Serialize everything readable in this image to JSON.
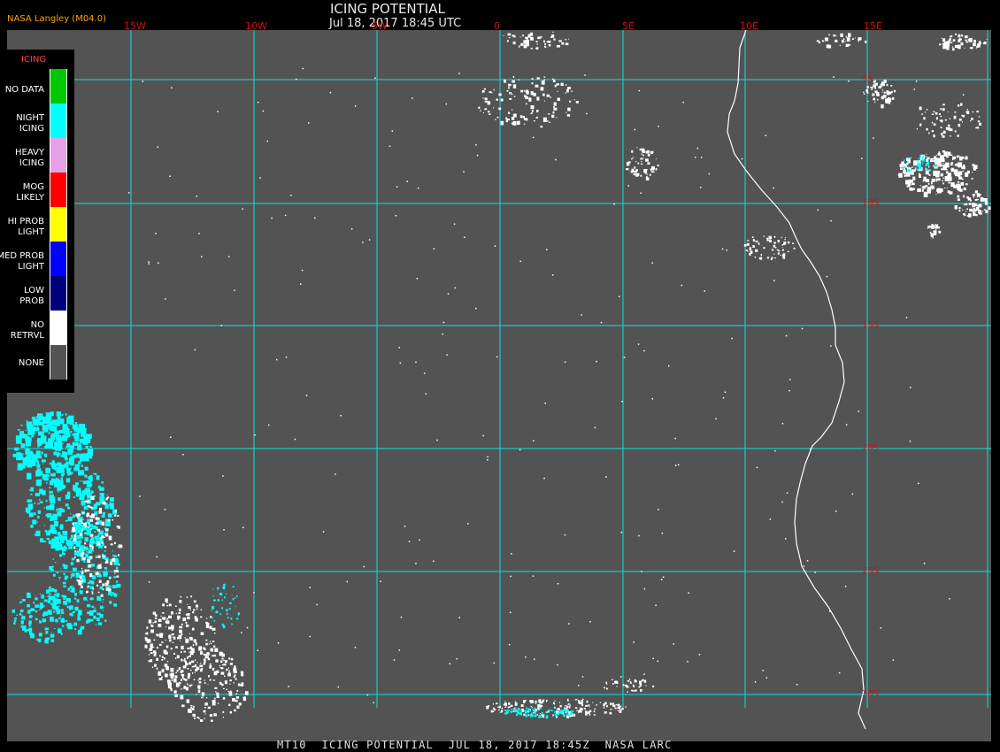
{
  "header": {
    "product_label": "NASA Langley (M04.0)",
    "title": "ICING POTENTIAL",
    "timestamp": "Jul 18, 2017 18:45 UTC"
  },
  "map": {
    "background_color": "#535353",
    "grid_color": "#00e5e5",
    "coast_color": "#ffffff",
    "longitude_labels": [
      "15W",
      "10W",
      "5W",
      "0",
      "5E",
      "10E",
      "15E"
    ],
    "latitude_labels": [
      "5S",
      "10S",
      "15S",
      "20S",
      "25S",
      "30S"
    ]
  },
  "legend": {
    "title": "ICING",
    "items": [
      {
        "label": "NO DATA",
        "color": "#00c800"
      },
      {
        "label": "NIGHT\nICING",
        "color": "#00ffff"
      },
      {
        "label": "HEAVY\nICING",
        "color": "#e6a0e6"
      },
      {
        "label": "MOG\nLIKELY",
        "color": "#ff0000"
      },
      {
        "label": "HI PROB\nLIGHT",
        "color": "#ffff00"
      },
      {
        "label": "MED PROB\nLIGHT",
        "color": "#0000ff"
      },
      {
        "label": "LOW\nPROB",
        "color": "#00007a"
      },
      {
        "label": "NO\nRETRVL",
        "color": "#ffffff"
      },
      {
        "label": "NONE",
        "color": "#535353"
      }
    ]
  },
  "footer": {
    "text": "MT10  ICING POTENTIAL  JUL 18, 2017 18:45Z  NASA LARC"
  }
}
